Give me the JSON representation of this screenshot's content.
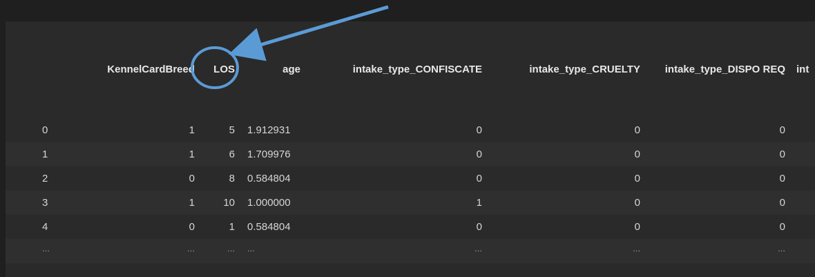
{
  "table": {
    "columns": [
      {
        "key": "index",
        "label": ""
      },
      {
        "key": "breed",
        "label": "KennelCardBreed"
      },
      {
        "key": "los",
        "label": "LOS"
      },
      {
        "key": "age",
        "label": "age"
      },
      {
        "key": "confiscate",
        "label": "intake_type_CONFISCATE"
      },
      {
        "key": "cruelty",
        "label": "intake_type_CRUELTY"
      },
      {
        "key": "dispo",
        "label": "intake_type_DISPO REQ"
      },
      {
        "key": "next",
        "label": "int"
      }
    ],
    "rows": [
      [
        "0",
        "1",
        "5",
        "1.912931",
        "0",
        "0",
        "0",
        ""
      ],
      [
        "1",
        "1",
        "6",
        "1.709976",
        "0",
        "0",
        "0",
        ""
      ],
      [
        "2",
        "0",
        "8",
        "0.584804",
        "0",
        "0",
        "0",
        ""
      ],
      [
        "3",
        "1",
        "10",
        "1.000000",
        "1",
        "0",
        "0",
        ""
      ],
      [
        "4",
        "0",
        "1",
        "0.584804",
        "0",
        "0",
        "0",
        ""
      ],
      [
        "...",
        "...",
        "...",
        "...",
        "...",
        "...",
        "...",
        ""
      ]
    ]
  },
  "annotation": {
    "target_column": "LOS",
    "color": "#5b9bd5"
  }
}
